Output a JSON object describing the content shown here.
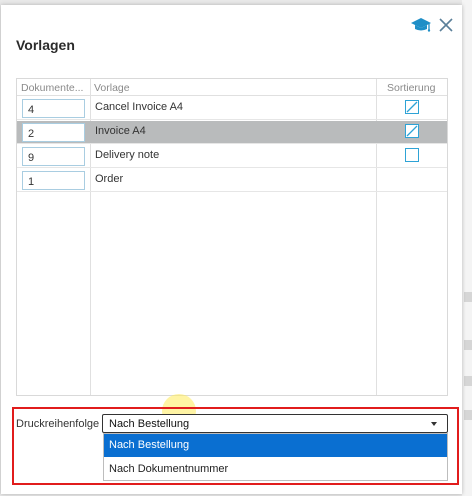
{
  "dialog": {
    "title": "Vorlagen"
  },
  "icons": {
    "help": "graduation-cap-icon",
    "close": "close-icon",
    "accent_color": "#1f8fc7"
  },
  "grid": {
    "columns": [
      "Dokumente...",
      "Vorlage",
      "Sortierung"
    ],
    "rows": [
      {
        "count": "4",
        "name": "Cancel Invoice A4",
        "checked": true
      },
      {
        "count": "2",
        "name": "Invoice A4",
        "checked": true,
        "selected": true
      },
      {
        "count": "9",
        "name": "Delivery note",
        "checked": false
      },
      {
        "count": "1",
        "name": "Order",
        "checked": null
      }
    ]
  },
  "print_order": {
    "label": "Druckreihenfolge",
    "selected_value": "Nach Bestellung",
    "options": [
      "Nach Bestellung",
      "Nach Dokumentnummer"
    ],
    "highlighted_option": "Nach Bestellung",
    "highlight_color": "#0a6fd1",
    "outline_color": "#e11c1c"
  }
}
